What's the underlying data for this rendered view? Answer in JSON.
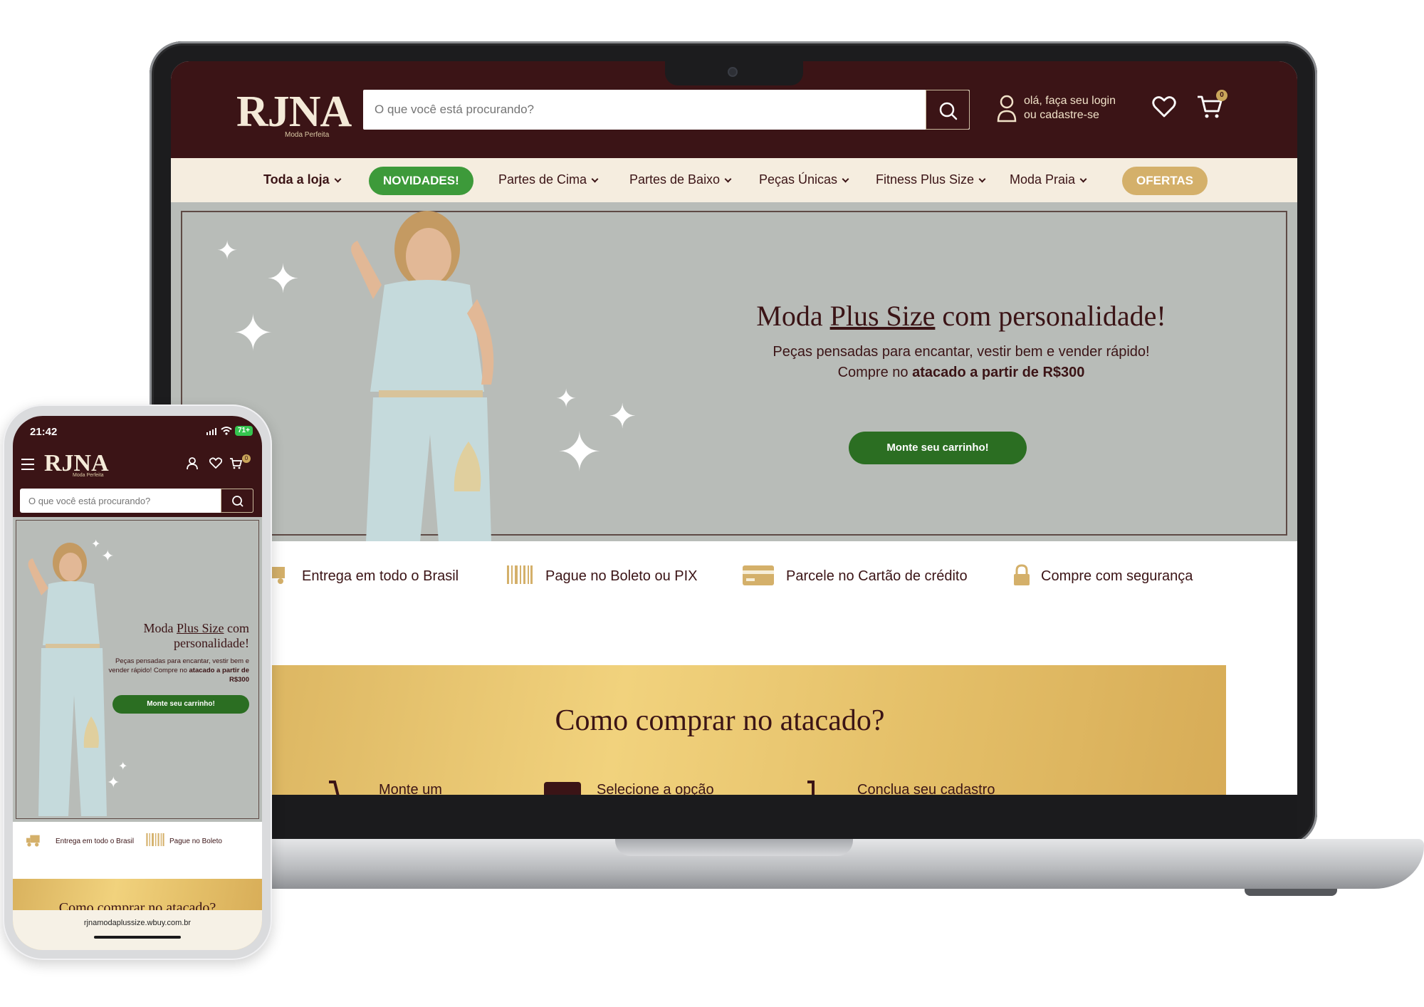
{
  "brand": {
    "logo_text": "RJNA",
    "logo_subtitle": "Moda Perfeita"
  },
  "header": {
    "search_placeholder": "O que você está procurando?",
    "login_line1": "olá, faça seu login",
    "login_line2": "ou cadastre-se",
    "cart_count": "0"
  },
  "nav": {
    "items": [
      {
        "label": "Toda a loja"
      },
      {
        "label": "NOVIDADES!"
      },
      {
        "label": "Partes de Cima"
      },
      {
        "label": "Partes de Baixo"
      },
      {
        "label": "Peças Únicas"
      },
      {
        "label": "Fitness Plus Size"
      },
      {
        "label": "Moda Praia"
      },
      {
        "label": "OFERTAS"
      }
    ]
  },
  "hero": {
    "title_before": "Moda ",
    "title_highlight": "Plus Size",
    "title_after": " com personalidade!",
    "line1": "Peças pensadas para encantar, vestir bem e vender rápido!",
    "line2_before": "Compre no ",
    "line2_bold": "atacado a partir de R$300",
    "mobile_text": "Peças pensadas para encantar, vestir bem e vender rápido! Compre no",
    "button_label": "Monte seu carrinho!"
  },
  "benefits": [
    {
      "label": "Entrega em todo o Brasil",
      "icon": "truck-icon"
    },
    {
      "label": "Pague no Boleto ou PIX",
      "icon": "barcode-icon"
    },
    {
      "label": "Parcele no Cartão de crédito",
      "icon": "credit-card-icon"
    },
    {
      "label": "Compre com segurança",
      "icon": "lock-icon"
    }
  ],
  "mobile_benefits": [
    {
      "label": "Entrega em todo o Brasil"
    },
    {
      "label": "Pague no Boleto"
    }
  ],
  "how_to_buy": {
    "title": "Como comprar no atacado?",
    "steps": [
      {
        "label": "Monte um"
      },
      {
        "label": "Selecione a opção"
      },
      {
        "label": "Conclua seu cadastro"
      }
    ]
  },
  "phone": {
    "time": "21:42",
    "battery": "71+",
    "url": "rjnamodaplussize.wbuy.com.br"
  },
  "colors": {
    "brand_dark": "#3b1416",
    "nav_bg": "#f5eddf",
    "hero_bg": "#b8bcb8",
    "green": "#2b6e22",
    "novidades_green": "#3d9a3a",
    "gold": "#d4b06a"
  }
}
